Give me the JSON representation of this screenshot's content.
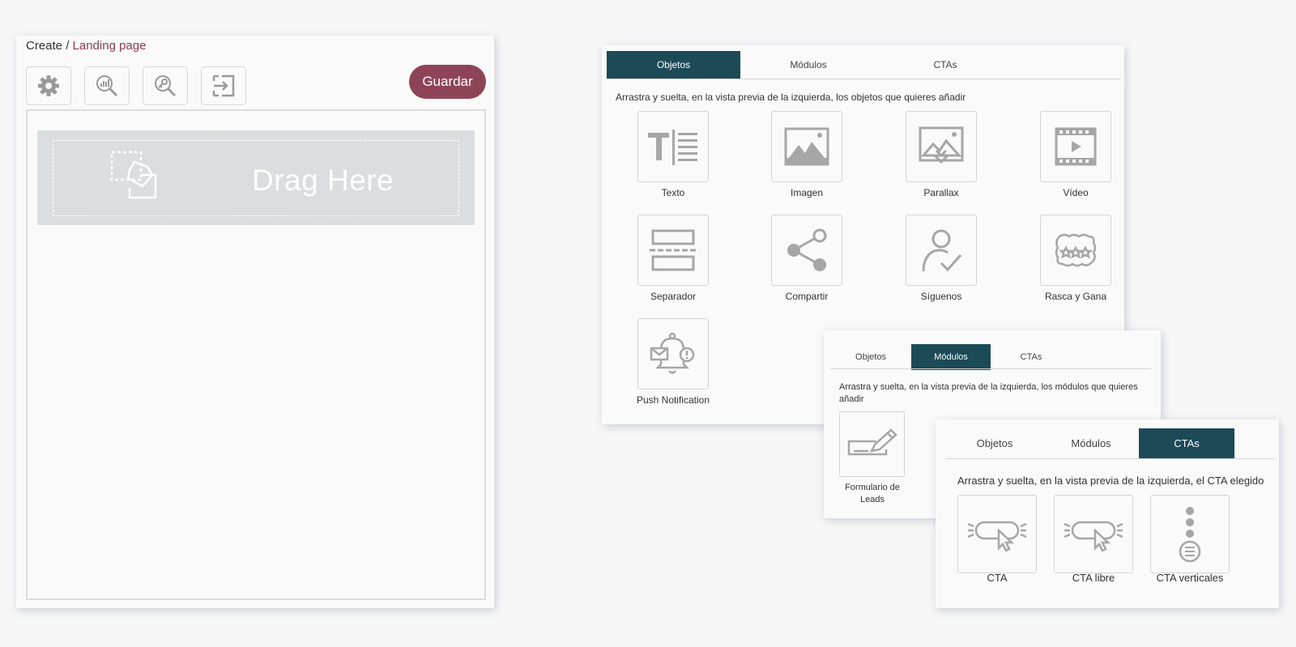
{
  "editor": {
    "breadcrumb_root": "Create /",
    "breadcrumb_current": "Landing page",
    "tools": [
      {
        "icon": "gear-icon"
      },
      {
        "icon": "analytics-search-icon"
      },
      {
        "icon": "key-search-icon"
      },
      {
        "icon": "exit-icon"
      }
    ],
    "save_label": "Guardar",
    "dropzone_text": "Drag Here",
    "accent_color": "#8e4457"
  },
  "panels": {
    "tab_active_color": "#1c4a57",
    "objetos": {
      "tabs": [
        "Objetos",
        "Módulos",
        "CTAs"
      ],
      "active_tab": "Objetos",
      "instructions": "Arrastra y suelta, en la vista previa de la izquierda, los objetos que quieres añadir",
      "items": [
        {
          "label": "Texto",
          "icon": "text-icon"
        },
        {
          "label": "Imagen",
          "icon": "image-icon"
        },
        {
          "label": "Parallax",
          "icon": "parallax-icon"
        },
        {
          "label": "Vídeo",
          "icon": "video-icon"
        },
        {
          "label": "Separador",
          "icon": "separator-icon"
        },
        {
          "label": "Compartir",
          "icon": "share-icon"
        },
        {
          "label": "Síguenos",
          "icon": "follow-icon"
        },
        {
          "label": "Rasca y Gana",
          "icon": "scratch-icon"
        },
        {
          "label": "Push Notification",
          "icon": "push-notification-icon"
        }
      ]
    },
    "modulos": {
      "tabs": [
        "Objetos",
        "Módulos",
        "CTAs"
      ],
      "active_tab": "Módulos",
      "instructions": "Arrastra y suelta, en la vista previa de la izquierda, los módulos que quieres añadir",
      "items": [
        {
          "label": "Formulario de Leads",
          "icon": "lead-form-icon"
        }
      ]
    },
    "ctas": {
      "tabs": [
        "Objetos",
        "Módulos",
        "CTAs"
      ],
      "active_tab": "CTAs",
      "instructions": "Arrastra y suelta, en la vista previa de la izquierda, el CTA elegido",
      "items": [
        {
          "label": "CTA",
          "icon": "cta-icon"
        },
        {
          "label": "CTA libre",
          "icon": "cta-free-icon"
        },
        {
          "label": "CTA verticales",
          "icon": "cta-vertical-icon"
        }
      ]
    }
  }
}
